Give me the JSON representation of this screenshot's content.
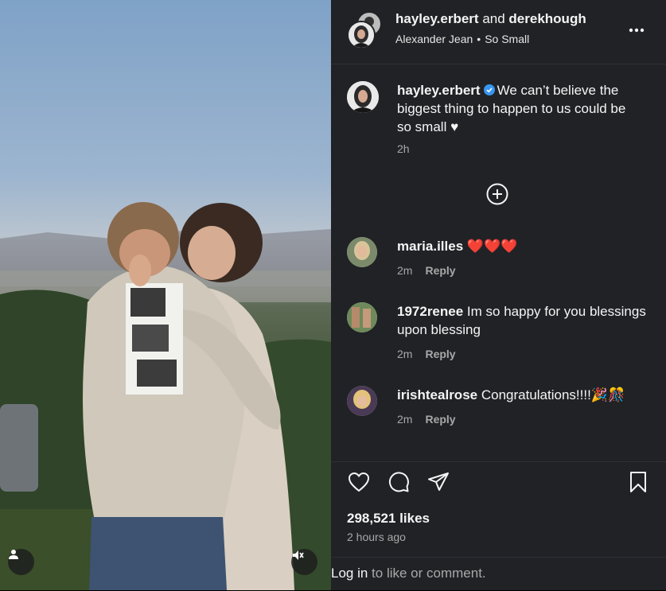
{
  "header": {
    "user1": "hayley.erbert",
    "joiner": "and",
    "user2": "derekhough",
    "audio_artist": "Alexander Jean",
    "audio_dot": "•",
    "audio_track": "So Small",
    "more_icon": "more-horizontal-icon"
  },
  "caption": {
    "username": "hayley.erbert",
    "text": "We can’t believe the biggest thing to happen to us could be so small ♥",
    "time": "2h",
    "verified": true
  },
  "comments": [
    {
      "username": "maria.illes",
      "text": "❤️❤️❤️",
      "time": "2m",
      "reply": "Reply"
    },
    {
      "username": "1972renee",
      "text": "Im so happy for you blessings upon blessing",
      "time": "2m",
      "reply": "Reply"
    },
    {
      "username": "irishtealrose",
      "text": "Congratulations!!!!🎉🎊",
      "time": "2m",
      "reply": "Reply"
    }
  ],
  "actions": {
    "like_icon": "heart-icon",
    "comment_icon": "comment-icon",
    "share_icon": "send-icon",
    "save_icon": "bookmark-icon"
  },
  "likes": "298,521 likes",
  "posted_ago": "2 hours ago",
  "login": {
    "link": "Log in",
    "rest": " to like or comment."
  },
  "colors": {
    "panel_bg": "#202226",
    "verified_blue": "#3897f0",
    "secondary_text": "#a8a8a8"
  }
}
